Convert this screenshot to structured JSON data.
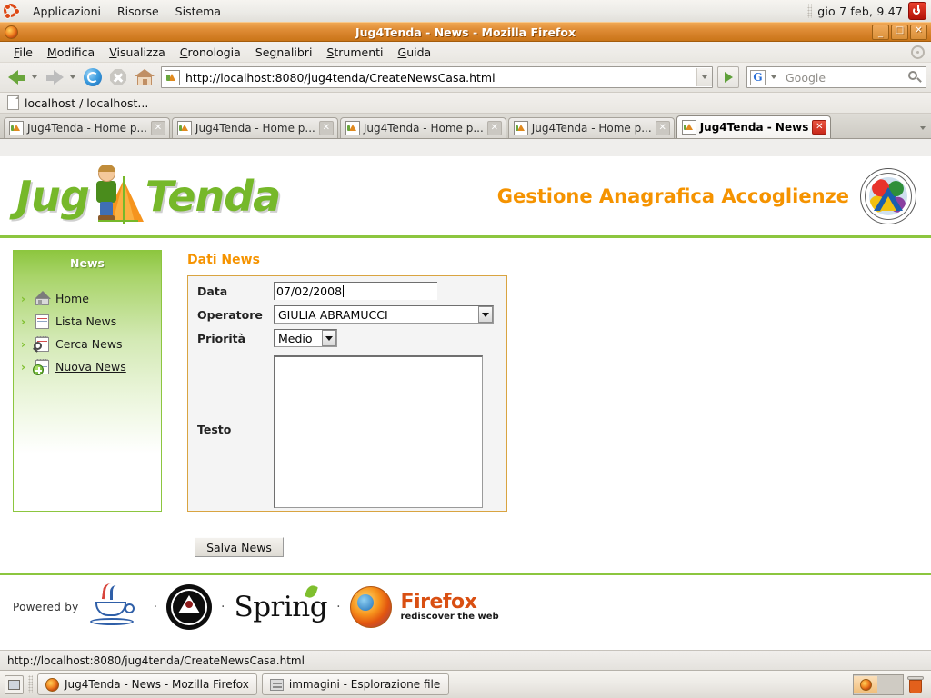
{
  "desktop": {
    "panel_menus": [
      "Applicazioni",
      "Risorse",
      "Sistema"
    ],
    "clock": "gio  7 feb,  9.47",
    "power_icon": "power-icon",
    "ubuntu_icon": "ubuntu-logo-icon"
  },
  "window": {
    "title": "Jug4Tenda - News - Mozilla Firefox",
    "minimize": "_",
    "maximize": "□",
    "close": "✕"
  },
  "menubar": {
    "items": [
      "File",
      "Modifica",
      "Visualizza",
      "Cronologia",
      "Segnalibri",
      "Strumenti",
      "Guida"
    ]
  },
  "toolbar": {
    "back_icon": "back-arrow-icon",
    "forward_icon": "forward-arrow-icon",
    "reload_icon": "reload-icon",
    "stop_icon": "stop-icon",
    "home_icon": "home-icon",
    "url": "http://localhost:8080/jug4tenda/CreateNewsCasa.html",
    "go_icon": "go-icon",
    "search_engine": "G",
    "search_placeholder": "Google",
    "search_icon": "magnifier-icon"
  },
  "bookmarks": {
    "items": [
      {
        "label": "localhost / localhost...",
        "icon": "page-icon"
      }
    ]
  },
  "tabs": [
    {
      "label": "Jug4Tenda - Home p...",
      "active": false
    },
    {
      "label": "Jug4Tenda - Home p...",
      "active": false
    },
    {
      "label": "Jug4Tenda - Home p...",
      "active": false
    },
    {
      "label": "Jug4Tenda - Home p...",
      "active": false
    },
    {
      "label": "Jug4Tenda - News",
      "active": true
    }
  ],
  "site": {
    "logo_part1": "Jug",
    "logo_part2": "Tenda",
    "app_title": "Gestione Anagrafica Accoglienze",
    "assoc_logo": "associazione-volontariato-logo"
  },
  "sidebar": {
    "title": "News",
    "items": [
      {
        "label": "Home",
        "icon": "home-icon",
        "current": false
      },
      {
        "label": "Lista News",
        "icon": "notepad-icon",
        "current": false
      },
      {
        "label": "Cerca News",
        "icon": "notepad-search-icon",
        "current": false
      },
      {
        "label": "Nuova News",
        "icon": "notepad-add-icon",
        "current": true
      }
    ]
  },
  "form": {
    "section_title": "Dati News",
    "fields": {
      "data_label": "Data",
      "data_value": "07/02/2008",
      "operatore_label": "Operatore",
      "operatore_value": "GIULIA ABRAMUCCI",
      "priorita_label": "Priorità",
      "priorita_value": "Medio",
      "testo_label": "Testo",
      "testo_value": ""
    },
    "save_button": "Salva News"
  },
  "footer": {
    "powered_by": "Powered by",
    "java_icon": "java-logo-icon",
    "jug_icon": "java-user-group-logo-icon",
    "spring_text": "Spring",
    "firefox_big": "Firefox",
    "firefox_tagline": "rediscover the web",
    "separator": "·"
  },
  "statusbar": {
    "text": "http://localhost:8080/jug4tenda/CreateNewsCasa.html"
  },
  "taskbar": {
    "show_desktop_icon": "show-desktop-icon",
    "tasks": [
      {
        "label": "Jug4Tenda - News - Mozilla Firefox",
        "icon": "firefox-icon"
      },
      {
        "label": "immagini - Esplorazione file",
        "icon": "file-manager-icon"
      }
    ],
    "trash_icon": "trash-icon",
    "workspace_icon": "workspace-switcher"
  },
  "colors": {
    "brand_green": "#8cc63f",
    "brand_orange": "#f59300",
    "titlebar_orange": "#d47f26",
    "form_border": "#d9a441"
  }
}
